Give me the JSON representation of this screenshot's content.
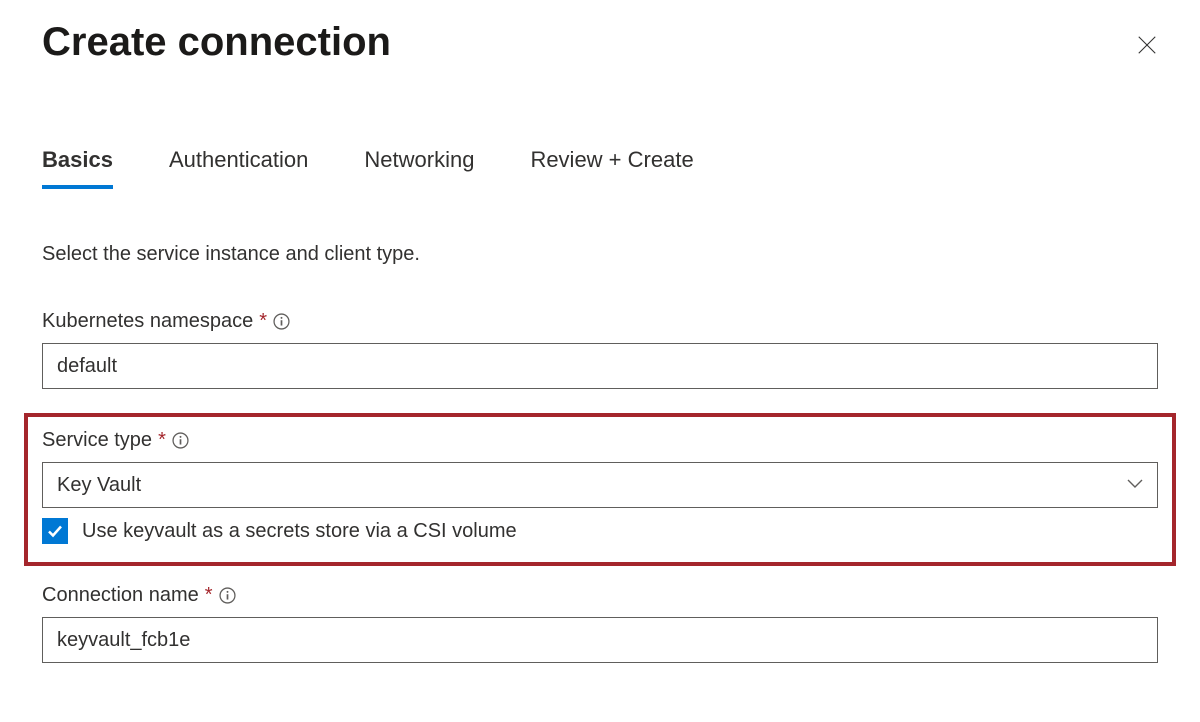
{
  "header": {
    "title": "Create connection"
  },
  "tabs": [
    {
      "label": "Basics",
      "active": true
    },
    {
      "label": "Authentication",
      "active": false
    },
    {
      "label": "Networking",
      "active": false
    },
    {
      "label": "Review + Create",
      "active": false
    }
  ],
  "description": "Select the service instance and client type.",
  "fields": {
    "namespace": {
      "label": "Kubernetes namespace",
      "value": "default"
    },
    "service_type": {
      "label": "Service type",
      "value": "Key Vault",
      "checkbox_label": "Use keyvault as a secrets store via a CSI volume"
    },
    "connection_name": {
      "label": "Connection name",
      "value": "keyvault_fcb1e"
    }
  }
}
